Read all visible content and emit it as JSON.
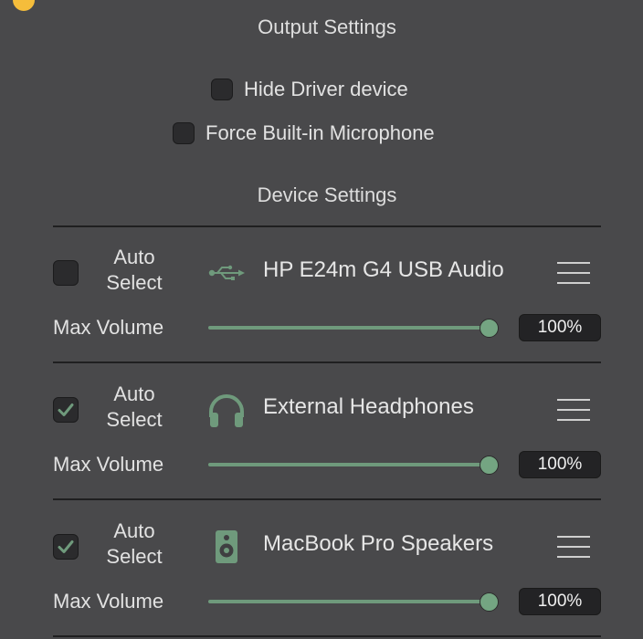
{
  "output_settings": {
    "title": "Output Settings",
    "hide_driver": {
      "label": "Hide Driver device",
      "checked": false
    },
    "force_builtin_mic": {
      "label": "Force Built-in Microphone",
      "checked": false
    }
  },
  "device_settings": {
    "title": "Device Settings",
    "auto_select_line1": "Auto",
    "auto_select_line2": "Select",
    "max_volume_label": "Max Volume",
    "devices": [
      {
        "name": "HP E24m G4 USB Audio",
        "icon": "usb-icon",
        "auto_select": false,
        "max_volume": 100,
        "max_volume_text": "100%"
      },
      {
        "name": "External Headphones",
        "icon": "headphones-icon",
        "auto_select": true,
        "max_volume": 100,
        "max_volume_text": "100%"
      },
      {
        "name": "MacBook Pro Speakers",
        "icon": "speaker-icon",
        "auto_select": true,
        "max_volume": 100,
        "max_volume_text": "100%"
      }
    ]
  },
  "colors": {
    "background": "#49494b",
    "accent": "#6f9a7c",
    "window_control_yellow": "#f5bd3b"
  }
}
